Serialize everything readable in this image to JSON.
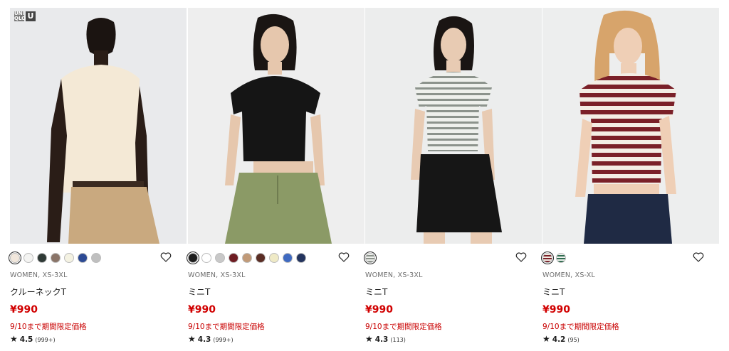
{
  "brand": {
    "logo_text_1": "UNI QLO",
    "logo_text_2": "U"
  },
  "colors": {
    "price": "#d10000",
    "promo": "#c90000",
    "background": "#ffffff"
  },
  "products": [
    {
      "gender_size": "WOMEN, XS-3XL",
      "name": "クルーネックT",
      "price": "¥990",
      "promo": "9/10まで期間限定価格",
      "rating": "4.5",
      "reviews": "(999+)",
      "swatches": [
        "#f1e7dc",
        "#f4f4f2",
        "#2f3a36",
        "#8a7468",
        "#f4f2e2",
        "#2c4a94",
        "#bfbfbf"
      ],
      "favorite_icon": "heart-outline-icon"
    },
    {
      "gender_size": "WOMEN, XS-3XL",
      "name": "ミニT",
      "price": "¥990",
      "promo": "9/10まで期間限定価格",
      "rating": "4.3",
      "reviews": "(999+)",
      "swatches": [
        "#1d1d1d",
        "#ffffff",
        "#c8c8c8",
        "#6e1c22",
        "#c19a78",
        "#5a2d24",
        "#efeac6",
        "#3f6ac1",
        "#23345e"
      ],
      "favorite_icon": "heart-outline-icon"
    },
    {
      "gender_size": "WOMEN, XS-3XL",
      "name": "ミニT",
      "price": "¥990",
      "promo": "9/10まで期間限定価格",
      "rating": "4.3",
      "reviews": "(113)",
      "swatches": [
        "stripe-gray"
      ],
      "favorite_icon": "heart-outline-icon"
    },
    {
      "gender_size": "WOMEN, XS-XL",
      "name": "ミニT",
      "price": "¥990",
      "promo": "9/10まで期間限定価格",
      "rating": "4.2",
      "reviews": "(95)",
      "swatches": [
        "stripe-burgundy",
        "stripe-green"
      ],
      "favorite_icon": "heart-outline-icon"
    }
  ]
}
